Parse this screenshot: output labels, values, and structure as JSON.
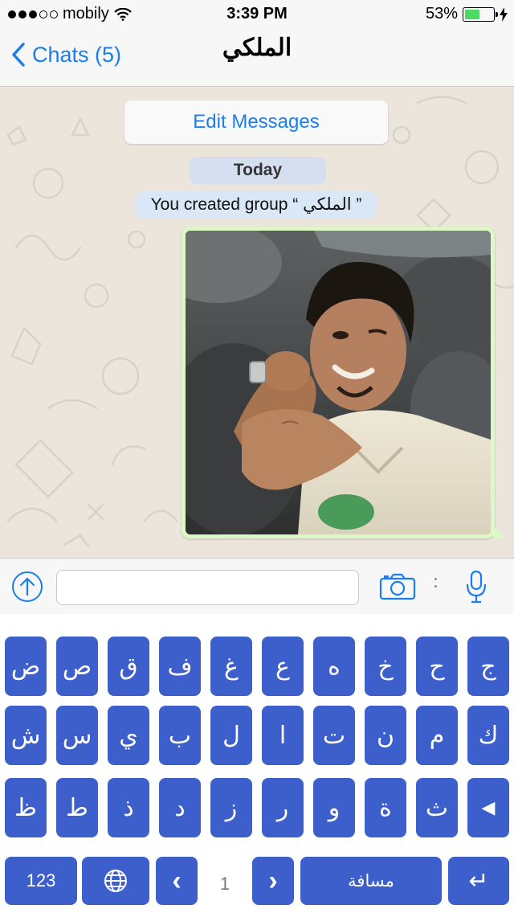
{
  "status_bar": {
    "carrier": "mobily",
    "time": "3:39 PM",
    "battery_percent": "53%",
    "battery_level": 0.53,
    "signal_bars_filled": 3,
    "signal_bars_total": 5
  },
  "nav": {
    "back_label": "Chats (5)",
    "title": "الملكي"
  },
  "chat": {
    "edit_messages_label": "Edit Messages",
    "date_label": "Today",
    "system_message": "You created group “ الملكي ”"
  },
  "input": {
    "value": "",
    "placeholder": ""
  },
  "keyboard": {
    "row1": [
      "ض",
      "ص",
      "ق",
      "ف",
      "غ",
      "ع",
      "ه",
      "خ",
      "ح",
      "ج"
    ],
    "row2": [
      "ش",
      "س",
      "ي",
      "ب",
      "ل",
      "ا",
      "ت",
      "ن",
      "م",
      "ك"
    ],
    "row3": [
      "ظ",
      "ط",
      "ذ",
      "د",
      "ز",
      "ر",
      "و",
      "ة",
      "ث",
      "◀"
    ],
    "numbers_label": "123",
    "prev_label": "‹",
    "page_number": "1",
    "next_label": "›",
    "space_label": "مسافة",
    "return_label": "↵"
  },
  "colors": {
    "ios_blue": "#1a7ef0",
    "key_blue": "#3d5fcc",
    "chat_bg": "#ebe5dc",
    "bubble_green": "#dcf8c6"
  },
  "icons": {
    "send": "arrow-up-circle-icon",
    "camera": "camera-icon",
    "mic": "microphone-icon",
    "back": "chevron-left-icon",
    "wifi": "wifi-icon",
    "charging": "bolt-icon",
    "globe": "globe-icon"
  }
}
